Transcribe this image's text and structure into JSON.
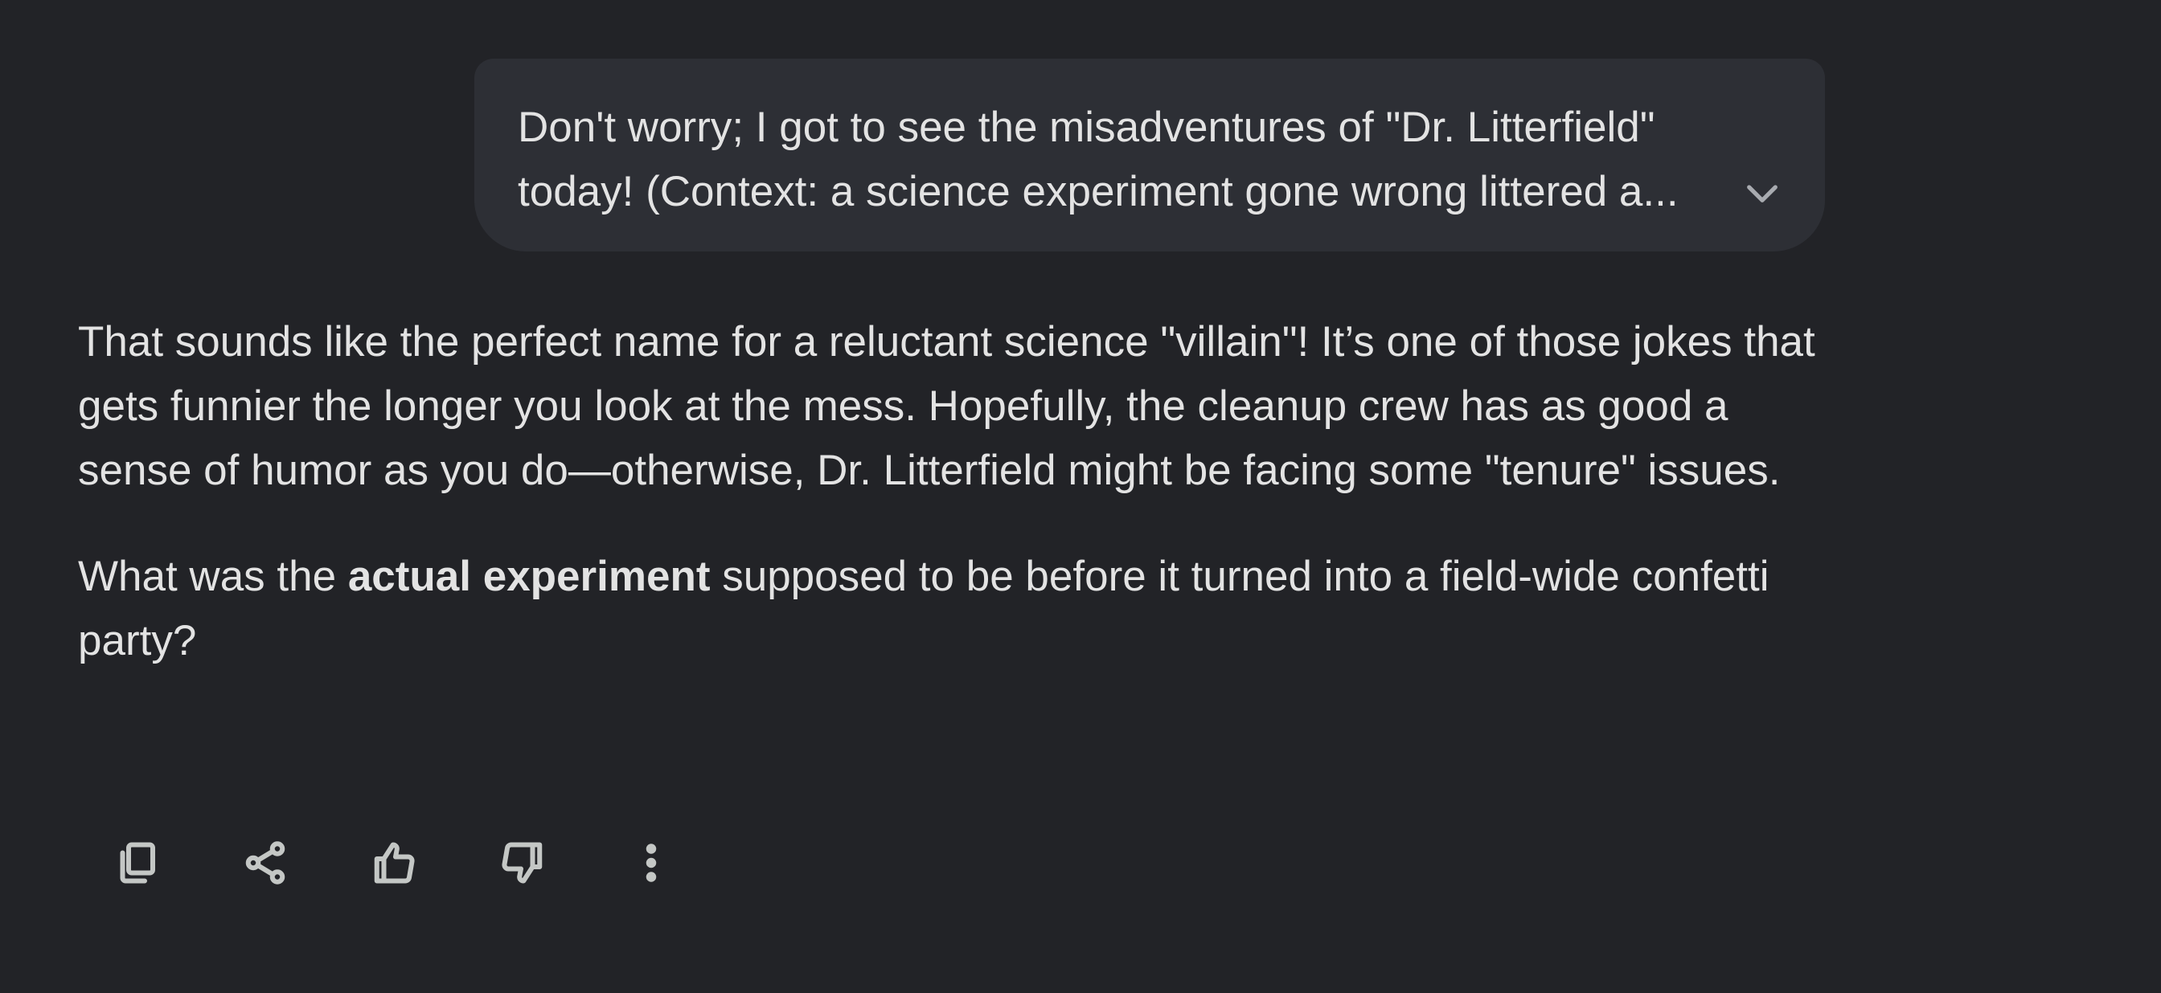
{
  "user_message": {
    "line1": "Don't worry; I got to see the misadventures of \"Dr. Litterfield\"",
    "line2": "today! (Context: a science experiment gone wrong littered a...",
    "expand_icon": "chevron-down-icon"
  },
  "response": {
    "paragraph1": "That sounds like the perfect name for a reluctant science \"villain\"! It’s one of those jokes that gets funnier the longer you look at the mess. Hopefully, the cleanup crew has as good a sense of humor as you do—otherwise, Dr. Litterfield might be facing some \"tenure\" issues.",
    "paragraph2_before": "What was the ",
    "paragraph2_bold": "actual experiment",
    "paragraph2_after": " supposed to be before it turned into a field-wide confetti party?"
  },
  "actions": {
    "copy_icon": "copy-icon",
    "share_icon": "share-icon",
    "thumbs_up_icon": "thumbs-up-icon",
    "thumbs_down_icon": "thumbs-down-icon",
    "more_icon": "more-vert-icon"
  },
  "colors": {
    "background": "#222327",
    "bubble": "#2d2f35",
    "text": "#e3e3e3",
    "icon": "#c4c7c5"
  }
}
